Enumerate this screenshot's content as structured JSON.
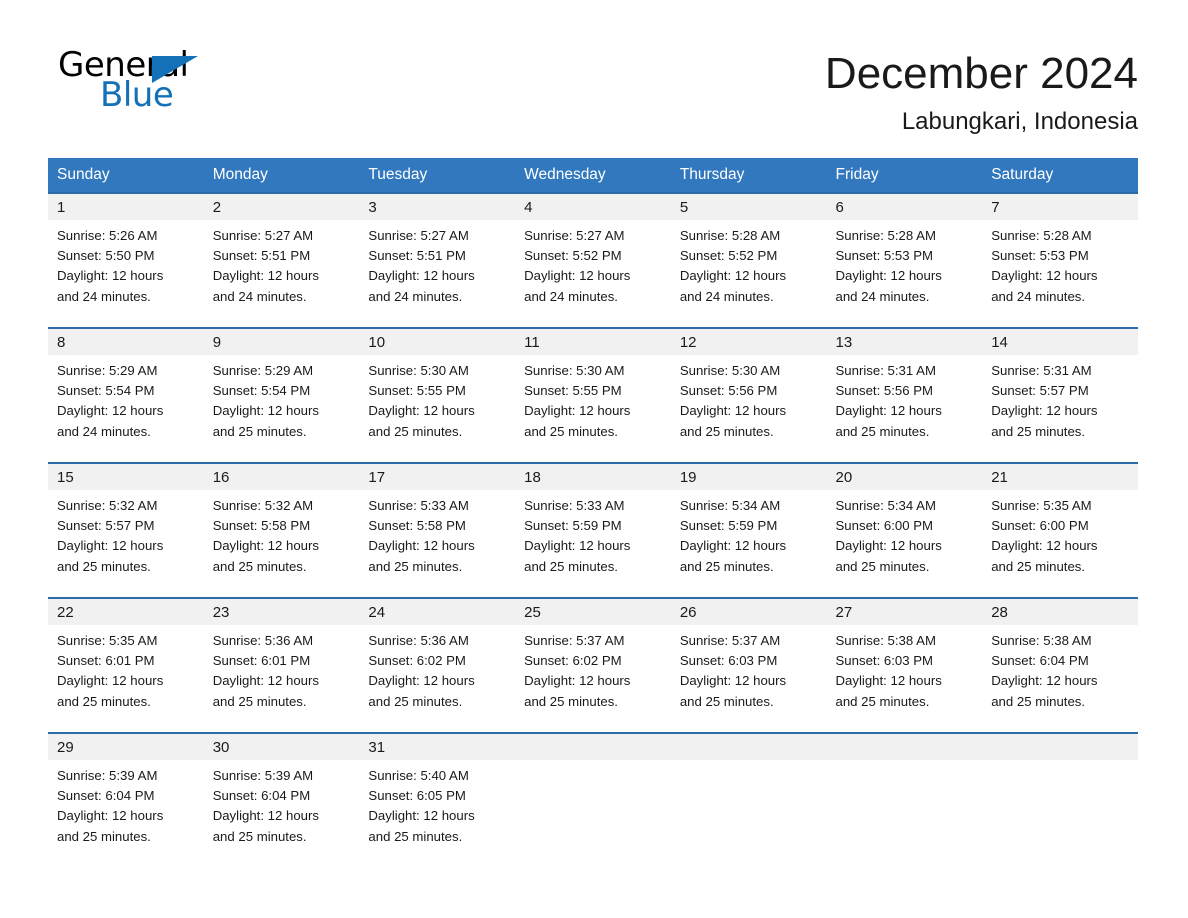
{
  "brand": {
    "name_part1": "General",
    "name_part2": "Blue",
    "accent_color": "#1471b8"
  },
  "header": {
    "month_title": "December 2024",
    "location": "Labungkari, Indonesia"
  },
  "calendar": {
    "header_color": "#3178be",
    "row_border_color": "#2a6ca8",
    "daynum_band_color": "#f1f1f1",
    "weekday_headers": [
      "Sunday",
      "Monday",
      "Tuesday",
      "Wednesday",
      "Thursday",
      "Friday",
      "Saturday"
    ],
    "weeks": [
      [
        {
          "day": "1",
          "sunrise": "Sunrise: 5:26 AM",
          "sunset": "Sunset: 5:50 PM",
          "daylight_line1": "Daylight: 12 hours",
          "daylight_line2": "and 24 minutes."
        },
        {
          "day": "2",
          "sunrise": "Sunrise: 5:27 AM",
          "sunset": "Sunset: 5:51 PM",
          "daylight_line1": "Daylight: 12 hours",
          "daylight_line2": "and 24 minutes."
        },
        {
          "day": "3",
          "sunrise": "Sunrise: 5:27 AM",
          "sunset": "Sunset: 5:51 PM",
          "daylight_line1": "Daylight: 12 hours",
          "daylight_line2": "and 24 minutes."
        },
        {
          "day": "4",
          "sunrise": "Sunrise: 5:27 AM",
          "sunset": "Sunset: 5:52 PM",
          "daylight_line1": "Daylight: 12 hours",
          "daylight_line2": "and 24 minutes."
        },
        {
          "day": "5",
          "sunrise": "Sunrise: 5:28 AM",
          "sunset": "Sunset: 5:52 PM",
          "daylight_line1": "Daylight: 12 hours",
          "daylight_line2": "and 24 minutes."
        },
        {
          "day": "6",
          "sunrise": "Sunrise: 5:28 AM",
          "sunset": "Sunset: 5:53 PM",
          "daylight_line1": "Daylight: 12 hours",
          "daylight_line2": "and 24 minutes."
        },
        {
          "day": "7",
          "sunrise": "Sunrise: 5:28 AM",
          "sunset": "Sunset: 5:53 PM",
          "daylight_line1": "Daylight: 12 hours",
          "daylight_line2": "and 24 minutes."
        }
      ],
      [
        {
          "day": "8",
          "sunrise": "Sunrise: 5:29 AM",
          "sunset": "Sunset: 5:54 PM",
          "daylight_line1": "Daylight: 12 hours",
          "daylight_line2": "and 24 minutes."
        },
        {
          "day": "9",
          "sunrise": "Sunrise: 5:29 AM",
          "sunset": "Sunset: 5:54 PM",
          "daylight_line1": "Daylight: 12 hours",
          "daylight_line2": "and 25 minutes."
        },
        {
          "day": "10",
          "sunrise": "Sunrise: 5:30 AM",
          "sunset": "Sunset: 5:55 PM",
          "daylight_line1": "Daylight: 12 hours",
          "daylight_line2": "and 25 minutes."
        },
        {
          "day": "11",
          "sunrise": "Sunrise: 5:30 AM",
          "sunset": "Sunset: 5:55 PM",
          "daylight_line1": "Daylight: 12 hours",
          "daylight_line2": "and 25 minutes."
        },
        {
          "day": "12",
          "sunrise": "Sunrise: 5:30 AM",
          "sunset": "Sunset: 5:56 PM",
          "daylight_line1": "Daylight: 12 hours",
          "daylight_line2": "and 25 minutes."
        },
        {
          "day": "13",
          "sunrise": "Sunrise: 5:31 AM",
          "sunset": "Sunset: 5:56 PM",
          "daylight_line1": "Daylight: 12 hours",
          "daylight_line2": "and 25 minutes."
        },
        {
          "day": "14",
          "sunrise": "Sunrise: 5:31 AM",
          "sunset": "Sunset: 5:57 PM",
          "daylight_line1": "Daylight: 12 hours",
          "daylight_line2": "and 25 minutes."
        }
      ],
      [
        {
          "day": "15",
          "sunrise": "Sunrise: 5:32 AM",
          "sunset": "Sunset: 5:57 PM",
          "daylight_line1": "Daylight: 12 hours",
          "daylight_line2": "and 25 minutes."
        },
        {
          "day": "16",
          "sunrise": "Sunrise: 5:32 AM",
          "sunset": "Sunset: 5:58 PM",
          "daylight_line1": "Daylight: 12 hours",
          "daylight_line2": "and 25 minutes."
        },
        {
          "day": "17",
          "sunrise": "Sunrise: 5:33 AM",
          "sunset": "Sunset: 5:58 PM",
          "daylight_line1": "Daylight: 12 hours",
          "daylight_line2": "and 25 minutes."
        },
        {
          "day": "18",
          "sunrise": "Sunrise: 5:33 AM",
          "sunset": "Sunset: 5:59 PM",
          "daylight_line1": "Daylight: 12 hours",
          "daylight_line2": "and 25 minutes."
        },
        {
          "day": "19",
          "sunrise": "Sunrise: 5:34 AM",
          "sunset": "Sunset: 5:59 PM",
          "daylight_line1": "Daylight: 12 hours",
          "daylight_line2": "and 25 minutes."
        },
        {
          "day": "20",
          "sunrise": "Sunrise: 5:34 AM",
          "sunset": "Sunset: 6:00 PM",
          "daylight_line1": "Daylight: 12 hours",
          "daylight_line2": "and 25 minutes."
        },
        {
          "day": "21",
          "sunrise": "Sunrise: 5:35 AM",
          "sunset": "Sunset: 6:00 PM",
          "daylight_line1": "Daylight: 12 hours",
          "daylight_line2": "and 25 minutes."
        }
      ],
      [
        {
          "day": "22",
          "sunrise": "Sunrise: 5:35 AM",
          "sunset": "Sunset: 6:01 PM",
          "daylight_line1": "Daylight: 12 hours",
          "daylight_line2": "and 25 minutes."
        },
        {
          "day": "23",
          "sunrise": "Sunrise: 5:36 AM",
          "sunset": "Sunset: 6:01 PM",
          "daylight_line1": "Daylight: 12 hours",
          "daylight_line2": "and 25 minutes."
        },
        {
          "day": "24",
          "sunrise": "Sunrise: 5:36 AM",
          "sunset": "Sunset: 6:02 PM",
          "daylight_line1": "Daylight: 12 hours",
          "daylight_line2": "and 25 minutes."
        },
        {
          "day": "25",
          "sunrise": "Sunrise: 5:37 AM",
          "sunset": "Sunset: 6:02 PM",
          "daylight_line1": "Daylight: 12 hours",
          "daylight_line2": "and 25 minutes."
        },
        {
          "day": "26",
          "sunrise": "Sunrise: 5:37 AM",
          "sunset": "Sunset: 6:03 PM",
          "daylight_line1": "Daylight: 12 hours",
          "daylight_line2": "and 25 minutes."
        },
        {
          "day": "27",
          "sunrise": "Sunrise: 5:38 AM",
          "sunset": "Sunset: 6:03 PM",
          "daylight_line1": "Daylight: 12 hours",
          "daylight_line2": "and 25 minutes."
        },
        {
          "day": "28",
          "sunrise": "Sunrise: 5:38 AM",
          "sunset": "Sunset: 6:04 PM",
          "daylight_line1": "Daylight: 12 hours",
          "daylight_line2": "and 25 minutes."
        }
      ],
      [
        {
          "day": "29",
          "sunrise": "Sunrise: 5:39 AM",
          "sunset": "Sunset: 6:04 PM",
          "daylight_line1": "Daylight: 12 hours",
          "daylight_line2": "and 25 minutes."
        },
        {
          "day": "30",
          "sunrise": "Sunrise: 5:39 AM",
          "sunset": "Sunset: 6:04 PM",
          "daylight_line1": "Daylight: 12 hours",
          "daylight_line2": "and 25 minutes."
        },
        {
          "day": "31",
          "sunrise": "Sunrise: 5:40 AM",
          "sunset": "Sunset: 6:05 PM",
          "daylight_line1": "Daylight: 12 hours",
          "daylight_line2": "and 25 minutes."
        },
        {
          "day": "",
          "sunrise": "",
          "sunset": "",
          "daylight_line1": "",
          "daylight_line2": ""
        },
        {
          "day": "",
          "sunrise": "",
          "sunset": "",
          "daylight_line1": "",
          "daylight_line2": ""
        },
        {
          "day": "",
          "sunrise": "",
          "sunset": "",
          "daylight_line1": "",
          "daylight_line2": ""
        },
        {
          "day": "",
          "sunrise": "",
          "sunset": "",
          "daylight_line1": "",
          "daylight_line2": ""
        }
      ]
    ]
  }
}
